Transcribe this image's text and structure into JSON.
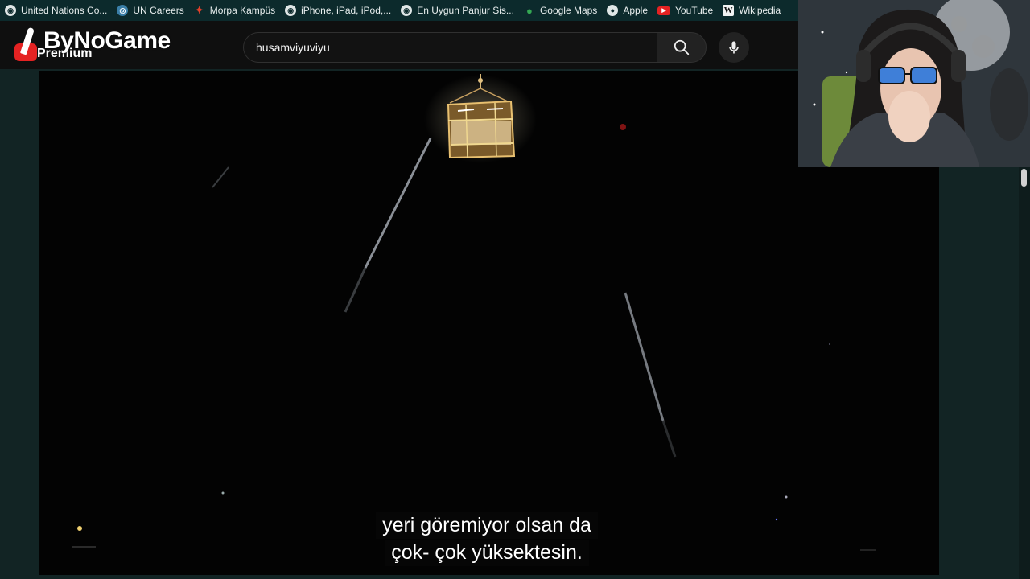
{
  "bookmarks": [
    {
      "label": "United Nations Co...",
      "icon": "globe-icon"
    },
    {
      "label": "UN Careers",
      "icon": "un-logo-icon"
    },
    {
      "label": "Morpa Kampüs",
      "icon": "morpa-logo-icon"
    },
    {
      "label": "iPhone, iPad, iPod,...",
      "icon": "globe-icon"
    },
    {
      "label": "En Uygun Panjur Sis...",
      "icon": "globe-icon"
    },
    {
      "label": "Google Maps",
      "icon": "map-pin-icon"
    },
    {
      "label": "Apple",
      "icon": "apple-logo-icon"
    },
    {
      "label": "YouTube",
      "icon": "youtube-logo-icon"
    },
    {
      "label": "Wikipedia",
      "icon": "wikipedia-logo-icon"
    }
  ],
  "logo": {
    "title": "ByNoGame",
    "subtitle": "Premium"
  },
  "search": {
    "value": "husamviyuviyu",
    "icon": "search-icon"
  },
  "mic": {
    "icon": "microphone-icon"
  },
  "subtitles": {
    "line1": "yeri göremiyor olsan da",
    "line2": "çok- çok yüksektesin."
  },
  "colors": {
    "bookmarks_bg": "#0c2a2c",
    "topbar_bg": "#0f0f0f",
    "page_bg": "#122424",
    "accent_red": "#e52222"
  }
}
